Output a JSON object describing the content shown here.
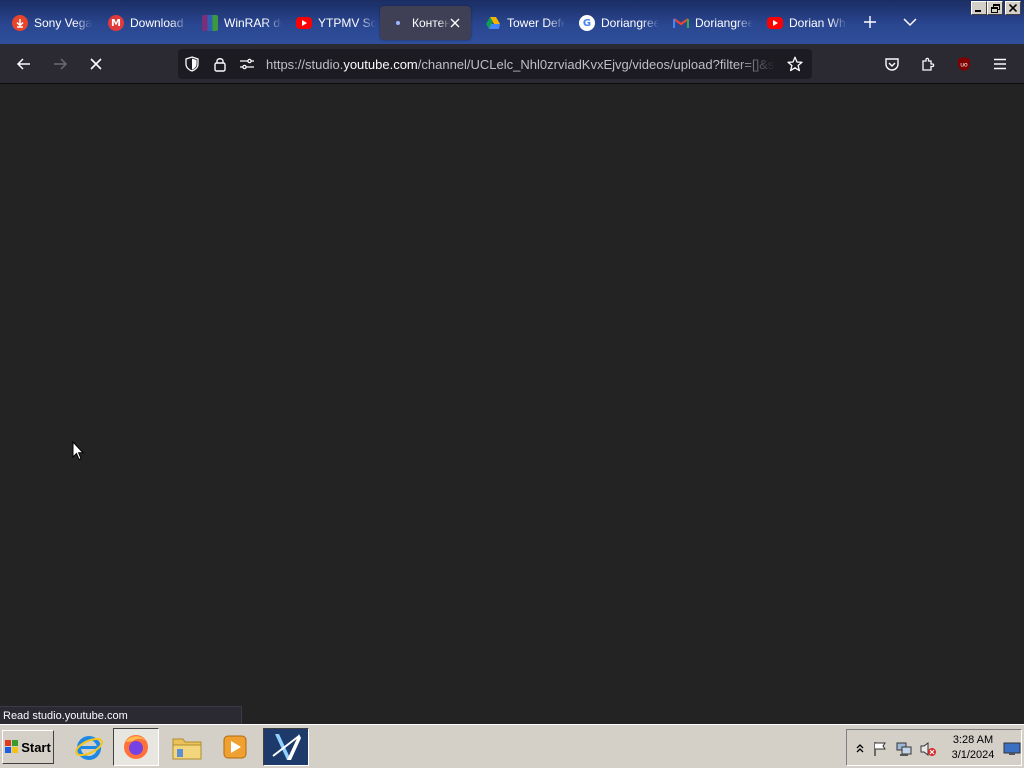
{
  "browser": {
    "tabs": [
      {
        "title": "Sony Vegas",
        "favicon": "download-icon",
        "color": "#e8452c"
      },
      {
        "title": "Download",
        "favicon": "m-logo-icon",
        "color": "#e03a3a"
      },
      {
        "title": "WinRAR download",
        "favicon": "winrar-icon",
        "color": "#8a3a8a"
      },
      {
        "title": "YTPMV Scan",
        "favicon": "youtube-icon",
        "color": "#ff0000"
      },
      {
        "title": "Контент",
        "favicon": "loading-dot-icon",
        "color": "#9fb4ff",
        "selected": true
      },
      {
        "title": "Tower Defense",
        "favicon": "drive-icon",
        "color": "#f4b400"
      },
      {
        "title": "Doriangreen",
        "favicon": "google-icon",
        "color": "#4285f4"
      },
      {
        "title": "Doriangreen",
        "favicon": "gmail-icon",
        "color": "#ea4335"
      },
      {
        "title": "Dorian White",
        "favicon": "youtube-icon",
        "color": "#ff0000"
      }
    ],
    "url": {
      "prefix": "https://studio.",
      "domain": "youtube.com",
      "suffix": "/channel/UCLelc_Nhl0zrviadKvxEjvg/videos/upload?filter=[]&sort={\"columnType\":\"date\""
    },
    "status_text": "Read studio.youtube.com"
  },
  "taskbar": {
    "start_label": "Start",
    "apps": [
      "internet-explorer",
      "firefox",
      "file-explorer",
      "media-player",
      "video-editor"
    ],
    "clock_time": "3:28 AM",
    "clock_date": "3/1/2024"
  }
}
